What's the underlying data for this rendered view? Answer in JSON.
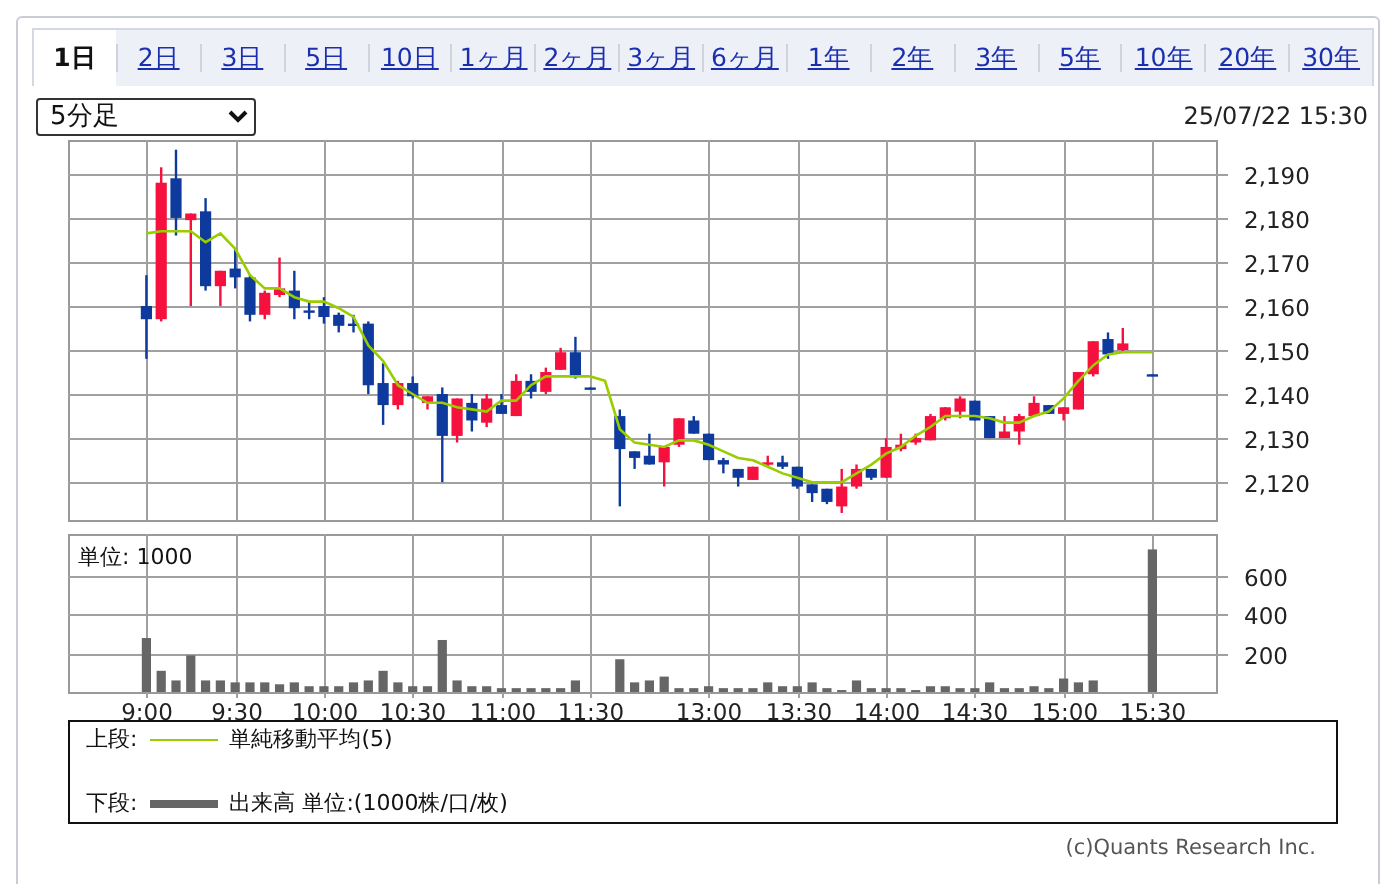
{
  "tabs": [
    {
      "label": "1日",
      "selected": true
    },
    {
      "label": "2日",
      "selected": false
    },
    {
      "label": "3日",
      "selected": false
    },
    {
      "label": "5日",
      "selected": false
    },
    {
      "label": "10日",
      "selected": false
    },
    {
      "label": "1ヶ月",
      "selected": false
    },
    {
      "label": "2ヶ月",
      "selected": false
    },
    {
      "label": "3ヶ月",
      "selected": false
    },
    {
      "label": "6ヶ月",
      "selected": false
    },
    {
      "label": "1年",
      "selected": false
    },
    {
      "label": "2年",
      "selected": false
    },
    {
      "label": "3年",
      "selected": false
    },
    {
      "label": "5年",
      "selected": false
    },
    {
      "label": "10年",
      "selected": false
    },
    {
      "label": "20年",
      "selected": false
    },
    {
      "label": "30年",
      "selected": false
    }
  ],
  "interval_select": {
    "value": "5分足"
  },
  "timestamp": "25/07/22 15:30",
  "price_chart": {
    "chart_data": {
      "type": "candlestick",
      "grid": true,
      "ylim": [
        2111.4,
        2197.7
      ],
      "yticks": [
        {
          "value": 2120,
          "label": "2,120"
        },
        {
          "value": 2130,
          "label": "2,130"
        },
        {
          "value": 2140,
          "label": "2,140"
        },
        {
          "value": 2150,
          "label": "2,150"
        },
        {
          "value": 2160,
          "label": "2,160"
        },
        {
          "value": 2170,
          "label": "2,170"
        },
        {
          "value": 2180,
          "label": "2,180"
        },
        {
          "value": 2190,
          "label": "2,190"
        }
      ],
      "ohlc": [
        [
          2160,
          2167,
          2148,
          2157
        ],
        [
          2157,
          2191.5,
          2156.5,
          2188
        ],
        [
          2189,
          2195.5,
          2176,
          2180
        ],
        [
          2179.5,
          2181,
          2160,
          2181
        ],
        [
          2181.5,
          2184.5,
          2163.5,
          2164.5
        ],
        [
          2164.5,
          2168,
          2160,
          2168
        ],
        [
          2168.5,
          2173,
          2164,
          2166.5
        ],
        [
          2166.5,
          2167,
          2156.5,
          2158
        ],
        [
          2158,
          2163.5,
          2157,
          2163
        ],
        [
          2162.5,
          2171,
          2162,
          2164
        ],
        [
          2163.5,
          2168,
          2157,
          2159.5
        ],
        [
          2159,
          2161,
          2157,
          2158.5
        ],
        [
          2160,
          2162,
          2156,
          2157.5
        ],
        [
          2158,
          2158.5,
          2154,
          2155.5
        ],
        [
          2156,
          2158,
          2154,
          2155.5
        ],
        [
          2156,
          2156.5,
          2140,
          2142
        ],
        [
          2142.5,
          2147,
          2133,
          2137.5
        ],
        [
          2137.5,
          2143,
          2136.5,
          2142.5
        ],
        [
          2142.5,
          2144,
          2139,
          2139.5
        ],
        [
          2138,
          2139.5,
          2136.5,
          2139.5
        ],
        [
          2140,
          2141.5,
          2120,
          2130.5
        ],
        [
          2130.5,
          2139,
          2129,
          2139
        ],
        [
          2138,
          2140,
          2131.5,
          2134
        ],
        [
          2133.5,
          2140,
          2132.5,
          2139
        ],
        [
          2137.5,
          2140,
          2135.5,
          2135.5
        ],
        [
          2135,
          2144.5,
          2135,
          2143
        ],
        [
          2143,
          2144.5,
          2139,
          2140.5
        ],
        [
          2140.5,
          2146,
          2140,
          2145
        ],
        [
          2145.5,
          2150.5,
          2145.5,
          2149.5
        ],
        [
          2149.5,
          2153,
          2143.5,
          2144
        ],
        [
          2141.5,
          2141.5,
          2141.5,
          2141.5
        ],
        null,
        [
          2135,
          2136.5,
          2114.5,
          2127.5
        ],
        [
          2127,
          2127,
          2123,
          2125.5
        ],
        [
          2126,
          2131,
          2124,
          2124
        ],
        [
          2124.5,
          2128,
          2119,
          2128
        ],
        [
          2128.5,
          2134.5,
          2128,
          2134.5
        ],
        [
          2134,
          2135,
          2131,
          2131
        ],
        [
          2131,
          2131,
          2125,
          2125
        ],
        [
          2125,
          2125.5,
          2122,
          2124
        ],
        [
          2123,
          2123,
          2119,
          2121
        ],
        [
          2120.5,
          2123.5,
          2120.5,
          2123.5
        ],
        [
          2124,
          2126,
          2123.5,
          2124.5
        ],
        [
          2124.5,
          2126,
          2123,
          2123.5
        ],
        [
          2123.5,
          2123.5,
          2118.5,
          2119
        ],
        [
          2119.5,
          2119.5,
          2115.5,
          2117.5
        ],
        [
          2118.5,
          2118.5,
          2115,
          2115.5
        ],
        [
          2114.5,
          2123,
          2113,
          2119
        ],
        [
          2119,
          2124,
          2118.5,
          2123
        ],
        [
          2123,
          2123,
          2120.5,
          2121
        ],
        [
          2121,
          2130,
          2121,
          2128
        ],
        [
          2127.5,
          2131,
          2127,
          2128.5
        ],
        [
          2129,
          2131,
          2128.5,
          2130
        ],
        [
          2129.5,
          2135.5,
          2129.5,
          2135
        ],
        [
          2134.5,
          2137,
          2134,
          2137
        ],
        [
          2136,
          2139.5,
          2134.5,
          2139
        ],
        [
          2138.5,
          2138.5,
          2134,
          2134
        ],
        [
          2135,
          2135,
          2130,
          2130
        ],
        [
          2130,
          2135,
          2130,
          2131.5
        ],
        [
          2131.5,
          2135.5,
          2128.5,
          2135
        ],
        [
          2135,
          2139.5,
          2135,
          2138
        ],
        [
          2137.5,
          2137.5,
          2135.5,
          2135.5
        ],
        [
          2135.5,
          2137,
          2134,
          2137
        ],
        [
          2136.5,
          2145,
          2136.5,
          2145
        ],
        [
          2144.5,
          2152,
          2144,
          2152
        ],
        [
          2152.5,
          2154,
          2148,
          2149
        ],
        [
          2150,
          2155,
          2149.5,
          2151.5
        ],
        null,
        [
          2144.5,
          2144.5,
          2144.5,
          2144.5
        ]
      ],
      "series": [
        {
          "name": "単純移動平均(5)",
          "type": "line",
          "color": "#9acd00",
          "values": [
            2176.5,
            2177,
            2177,
            2177,
            2174.5,
            2176.5,
            2173,
            2167,
            2164,
            2164,
            2162,
            2161,
            2161,
            2159.5,
            2157.5,
            2151,
            2147.5,
            2142,
            2140,
            2138,
            2138,
            2137,
            2136.5,
            2136,
            2138.5,
            2138.5,
            2142,
            2144,
            2144,
            2144,
            2144,
            2143,
            2132,
            2129,
            2128.5,
            2128,
            2129.5,
            2129.5,
            2128.5,
            2127,
            2125.5,
            2125,
            2123.5,
            2122,
            2121,
            2120,
            2120,
            2120,
            2122,
            2124,
            2126.5,
            2128,
            2130.5,
            2132.5,
            2135,
            2135,
            2135,
            2134.5,
            2133.5,
            2133.5,
            2135,
            2136,
            2139,
            2143,
            2146.5,
            2149,
            2149.5,
            2149.5,
            2149.5
          ]
        }
      ]
    }
  },
  "volume_chart": {
    "unit_label": "単位: 1000",
    "chart_data": {
      "type": "bar",
      "grid": true,
      "ylim": [
        0,
        820
      ],
      "yticks": [
        200,
        400,
        600
      ],
      "categories": [
        "9:00",
        null,
        null,
        null,
        null,
        null,
        "9:30",
        null,
        null,
        null,
        null,
        null,
        "10:00",
        null,
        null,
        null,
        null,
        null,
        "10:30",
        null,
        null,
        null,
        null,
        null,
        "11:00",
        null,
        null,
        null,
        null,
        null,
        "11:30",
        null,
        null,
        null,
        null,
        null,
        null,
        null,
        "13:00",
        null,
        null,
        null,
        null,
        null,
        "13:30",
        null,
        null,
        null,
        null,
        null,
        "14:00",
        null,
        null,
        null,
        null,
        null,
        "14:30",
        null,
        null,
        null,
        null,
        null,
        "15:00",
        null,
        null,
        null,
        null,
        null,
        "15:30"
      ],
      "series": [
        {
          "name": "出来高 単位:(1000株/口/枚)",
          "color": "#666666",
          "values": [
            280,
            110,
            60,
            190,
            60,
            60,
            50,
            50,
            50,
            40,
            50,
            30,
            30,
            30,
            50,
            60,
            110,
            50,
            30,
            30,
            270,
            60,
            30,
            30,
            20,
            20,
            20,
            20,
            20,
            60,
            null,
            null,
            170,
            50,
            60,
            80,
            20,
            20,
            30,
            20,
            20,
            20,
            50,
            30,
            30,
            50,
            20,
            10,
            60,
            20,
            20,
            20,
            10,
            30,
            30,
            20,
            20,
            50,
            20,
            20,
            30,
            20,
            70,
            50,
            60,
            null,
            null,
            null,
            740
          ]
        }
      ]
    }
  },
  "legend": [
    {
      "prefix": "上段:",
      "kind": "line"
    },
    {
      "prefix": "下段:",
      "kind": "bar"
    }
  ],
  "footer": "(c)Quants Research Inc."
}
